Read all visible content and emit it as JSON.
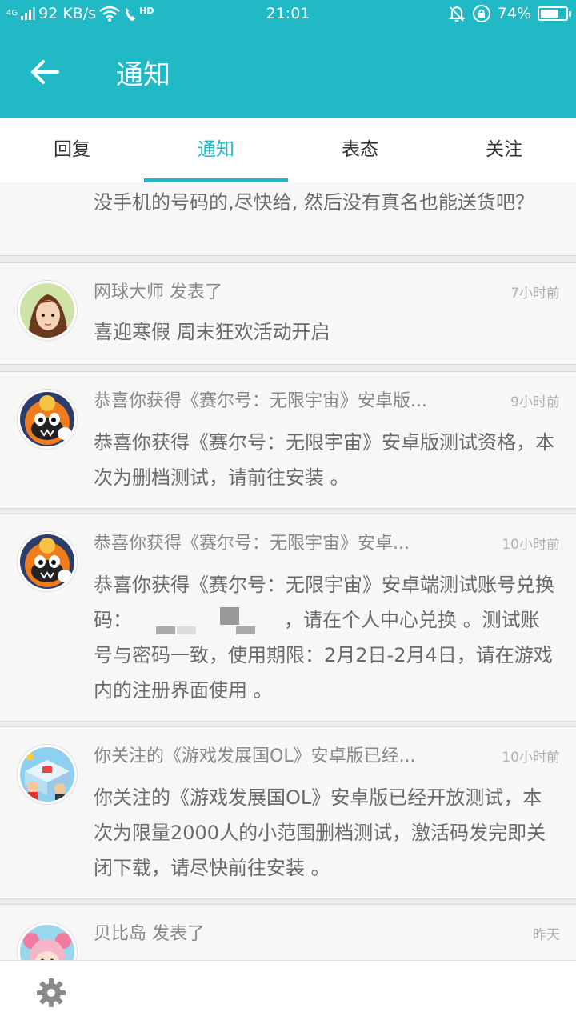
{
  "status_bar": {
    "network": "4G",
    "speed": "92 KB/s",
    "hd": "HD",
    "time": "21:01",
    "battery_text": "74%",
    "battery_level": 0.74
  },
  "header": {
    "title": "通知"
  },
  "tabs": [
    {
      "label": "回复",
      "active": false
    },
    {
      "label": "通知",
      "active": true
    },
    {
      "label": "表态",
      "active": false
    },
    {
      "label": "关注",
      "active": false
    }
  ],
  "notifications": [
    {
      "title": "",
      "time": "",
      "body": "没手机的号码的,尽快给, 然后没有真名也能送货吧？",
      "avatar_icon": "pink-avatar-icon"
    },
    {
      "title": "网球大师 发表了",
      "time": "7小时前",
      "body": "喜迎寒假 周末狂欢活动开启",
      "avatar_icon": "girl-avatar-icon"
    },
    {
      "title": "恭喜你获得《赛尔号：无限宇宙》安卓版...",
      "time": "9小时前",
      "body": "恭喜你获得《赛尔号：无限宇宙》安卓版测试资格，本次为删档测试，请前往安装 。",
      "avatar_icon": "seer-game-icon"
    },
    {
      "title": "恭喜你获得《赛尔号：无限宇宙》安卓...",
      "time": "10小时前",
      "body_prefix": "恭喜你获得《赛尔号：无限宇宙》安卓端测试账号兑换码：",
      "body_suffix": "，请在个人中心兑换 。测试账号与密码一致，使用期限：2月2日-2月4日，请在游戏内的注册界面使用 。",
      "avatar_icon": "seer-game-icon"
    },
    {
      "title": "你关注的《游戏发展国OL》安卓版已经...",
      "time": "10小时前",
      "body": "你关注的《游戏发展国OL》安卓版已经开放测试，本次为限量2000人的小范围删档测试，激活码发完即关闭下载，请尽快前往安装 。",
      "avatar_icon": "game-dev-story-icon"
    },
    {
      "title": "贝比岛 发表了",
      "time": "昨天",
      "body": "",
      "avatar_icon": "beibi-island-icon"
    }
  ],
  "bottom_bar": {
    "settings_icon": "gear-icon"
  },
  "colors": {
    "accent": "#20b9c5",
    "card_bg": "#f7f7f7",
    "divider_bg": "#ebebeb"
  }
}
